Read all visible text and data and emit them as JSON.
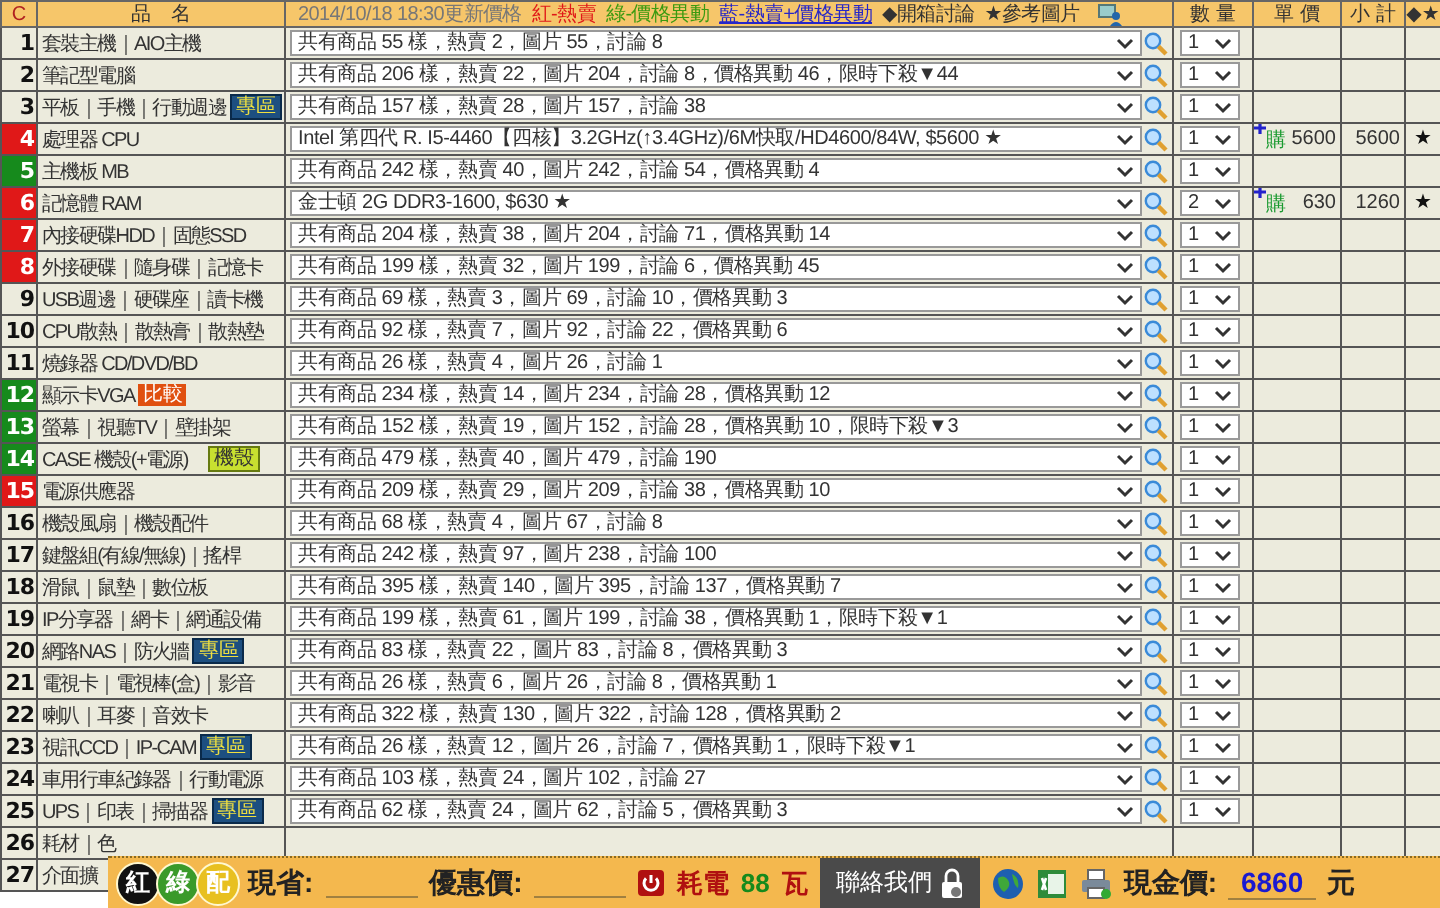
{
  "header": {
    "corner": "C",
    "name_heading": "品　名",
    "updated": "2014/10/18 18:30更新價格",
    "legend": [
      {
        "text": "紅-熱賣",
        "kind": "hot"
      },
      {
        "text": "綠-價格異動",
        "kind": "change"
      },
      {
        "text": "藍-熱賣+價格異動",
        "kind": "both"
      }
    ],
    "notes": [
      "◆開箱討論",
      "★參考圖片"
    ],
    "qty": "數 量",
    "unit": "單 價",
    "subtotal": "小 計",
    "marks": "◆★"
  },
  "rows": [
    {
      "no": "1",
      "name": "套裝主機｜AIO主機",
      "summary": "共有商品 55 樣，熱賣 2，圖片 55，討論 8",
      "qty": "1"
    },
    {
      "no": "2",
      "name": "筆記型電腦",
      "summary": "共有商品 206 樣，熱賣 22，圖片 204，討論 8，價格異動 46，限時下殺▼44",
      "qty": "1"
    },
    {
      "no": "3",
      "name": "平板｜手機｜行動週邊",
      "badge": {
        "text": "專區",
        "kind": "zone"
      },
      "summary": "共有商品 157 樣，熱賣 28，圖片 157，討論 38",
      "qty": "1"
    },
    {
      "no": "4",
      "name": "處理器 CPU",
      "color": "#e01818",
      "summary": "Intel 第四代 R. I5-4460【四核】3.2GHz(↑3.4GHz)/6M快取/HD4600/84W, $5600 ★",
      "qty": "1",
      "buy": "購",
      "unit_price": "5600",
      "subtotal": "5600",
      "mark": "★"
    },
    {
      "no": "5",
      "name": "主機板 MB",
      "color": "#168a1c",
      "summary": "共有商品 242 樣，熱賣 40，圖片 242，討論 54，價格異動 4",
      "qty": "1"
    },
    {
      "no": "6",
      "name": "記憶體 RAM",
      "color": "#e01818",
      "summary": "金士頓 2G DDR3-1600, $630 ★",
      "qty": "2",
      "buy": "購",
      "unit_price": "630",
      "subtotal": "1260",
      "mark": "★"
    },
    {
      "no": "7",
      "name": "內接硬碟HDD｜固態SSD",
      "color": "#e01818",
      "summary": "共有商品 204 樣，熱賣 38，圖片 204，討論 71，價格異動 14",
      "qty": "1"
    },
    {
      "no": "8",
      "name": "外接硬碟｜隨身碟｜記憶卡",
      "color": "#e01818",
      "summary": "共有商品 199 樣，熱賣 32，圖片 199，討論 6，價格異動 45",
      "qty": "1"
    },
    {
      "no": "9",
      "name": "USB週邊｜硬碟座｜讀卡機",
      "summary": "共有商品 69 樣，熱賣 3，圖片 69，討論 10，價格異動 3",
      "qty": "1"
    },
    {
      "no": "10",
      "name": "CPU散熱｜散熱膏｜散熱墊",
      "summary": "共有商品 92 樣，熱賣 7，圖片 92，討論 22，價格異動 6",
      "qty": "1"
    },
    {
      "no": "11",
      "name": "燒錄器 CD/DVD/BD",
      "summary": "共有商品 26 樣，熱賣 4，圖片 26，討論 1",
      "qty": "1"
    },
    {
      "no": "12",
      "name": "顯示卡VGA",
      "color": "#168a1c",
      "badge": {
        "text": "比較",
        "kind": "compare"
      },
      "summary": "共有商品 234 樣，熱賣 14，圖片 234，討論 28，價格異動 12",
      "qty": "1"
    },
    {
      "no": "13",
      "name": "螢幕｜視聽TV｜壁掛架",
      "color": "#168a1c",
      "summary": "共有商品 152 樣，熱賣 19，圖片 152，討論 28，價格異動 10，限時下殺▼3",
      "qty": "1"
    },
    {
      "no": "14",
      "name": "CASE 機殼(+電源)",
      "color": "#168a1c",
      "badge": {
        "text": "機殼",
        "kind": "case"
      },
      "summary": "共有商品 479 樣，熱賣 40，圖片 479，討論 190",
      "qty": "1"
    },
    {
      "no": "15",
      "name": "電源供應器",
      "color": "#e01818",
      "summary": "共有商品 209 樣，熱賣 29，圖片 209，討論 38，價格異動 10",
      "qty": "1"
    },
    {
      "no": "16",
      "name": "機殼風扇｜機殼配件",
      "summary": "共有商品 68 樣，熱賣 4，圖片 67，討論 8",
      "qty": "1"
    },
    {
      "no": "17",
      "name": "鍵盤組(有線/無線)｜搖桿",
      "summary": "共有商品 242 樣，熱賣 97，圖片 238，討論 100",
      "qty": "1"
    },
    {
      "no": "18",
      "name": "滑鼠｜鼠墊｜數位板",
      "summary": "共有商品 395 樣，熱賣 140，圖片 395，討論 137，價格異動 7",
      "qty": "1"
    },
    {
      "no": "19",
      "name": "IP分享器｜網卡｜網通設備",
      "summary": "共有商品 199 樣，熱賣 61，圖片 199，討論 38，價格異動 1，限時下殺▼1",
      "qty": "1"
    },
    {
      "no": "20",
      "name": "網路NAS｜防火牆",
      "badge": {
        "text": "專區",
        "kind": "zone"
      },
      "summary": "共有商品 83 樣，熱賣 22，圖片 83，討論 8，價格異動 3",
      "qty": "1"
    },
    {
      "no": "21",
      "name": "電視卡｜電視棒(盒)｜影音",
      "summary": "共有商品 26 樣，熱賣 6，圖片 26，討論 8，價格異動 1",
      "qty": "1"
    },
    {
      "no": "22",
      "name": "喇叭｜耳麥｜音效卡",
      "summary": "共有商品 322 樣，熱賣 130，圖片 322，討論 128，價格異動 2",
      "qty": "1"
    },
    {
      "no": "23",
      "name": "視訊CCD｜IP-CAM",
      "badge": {
        "text": "專區",
        "kind": "zone"
      },
      "summary": "共有商品 26 樣，熱賣 12，圖片 26，討論 7，價格異動 1，限時下殺▼1",
      "qty": "1"
    },
    {
      "no": "24",
      "name": "車用行車紀錄器｜行動電源",
      "summary": "共有商品 103 樣，熱賣 24，圖片 102，討論 27",
      "qty": "1"
    },
    {
      "no": "25",
      "name": "UPS｜印表｜掃描器",
      "badge": {
        "text": "專區",
        "kind": "zone"
      },
      "summary": "共有商品 62 樣，熱賣 24，圖片 62，討論 5，價格異動 3",
      "qty": "1"
    },
    {
      "no": "26",
      "name": "耗材｜色"
    },
    {
      "no": "27",
      "name": "介面擴"
    }
  ],
  "footer": {
    "logo": [
      {
        "text": "紅",
        "color": "#111111"
      },
      {
        "text": "綠",
        "color": "#3a9a2a"
      },
      {
        "text": "配",
        "color": "#e8c020"
      }
    ],
    "saved_label": "現省:",
    "discount_label": "優惠價:",
    "power_label": "耗電",
    "power_value": "88",
    "power_unit": "瓦",
    "contact_button": "聯絡我們",
    "cash_label": "現金價:",
    "cash_value": "6860",
    "currency": "元"
  }
}
